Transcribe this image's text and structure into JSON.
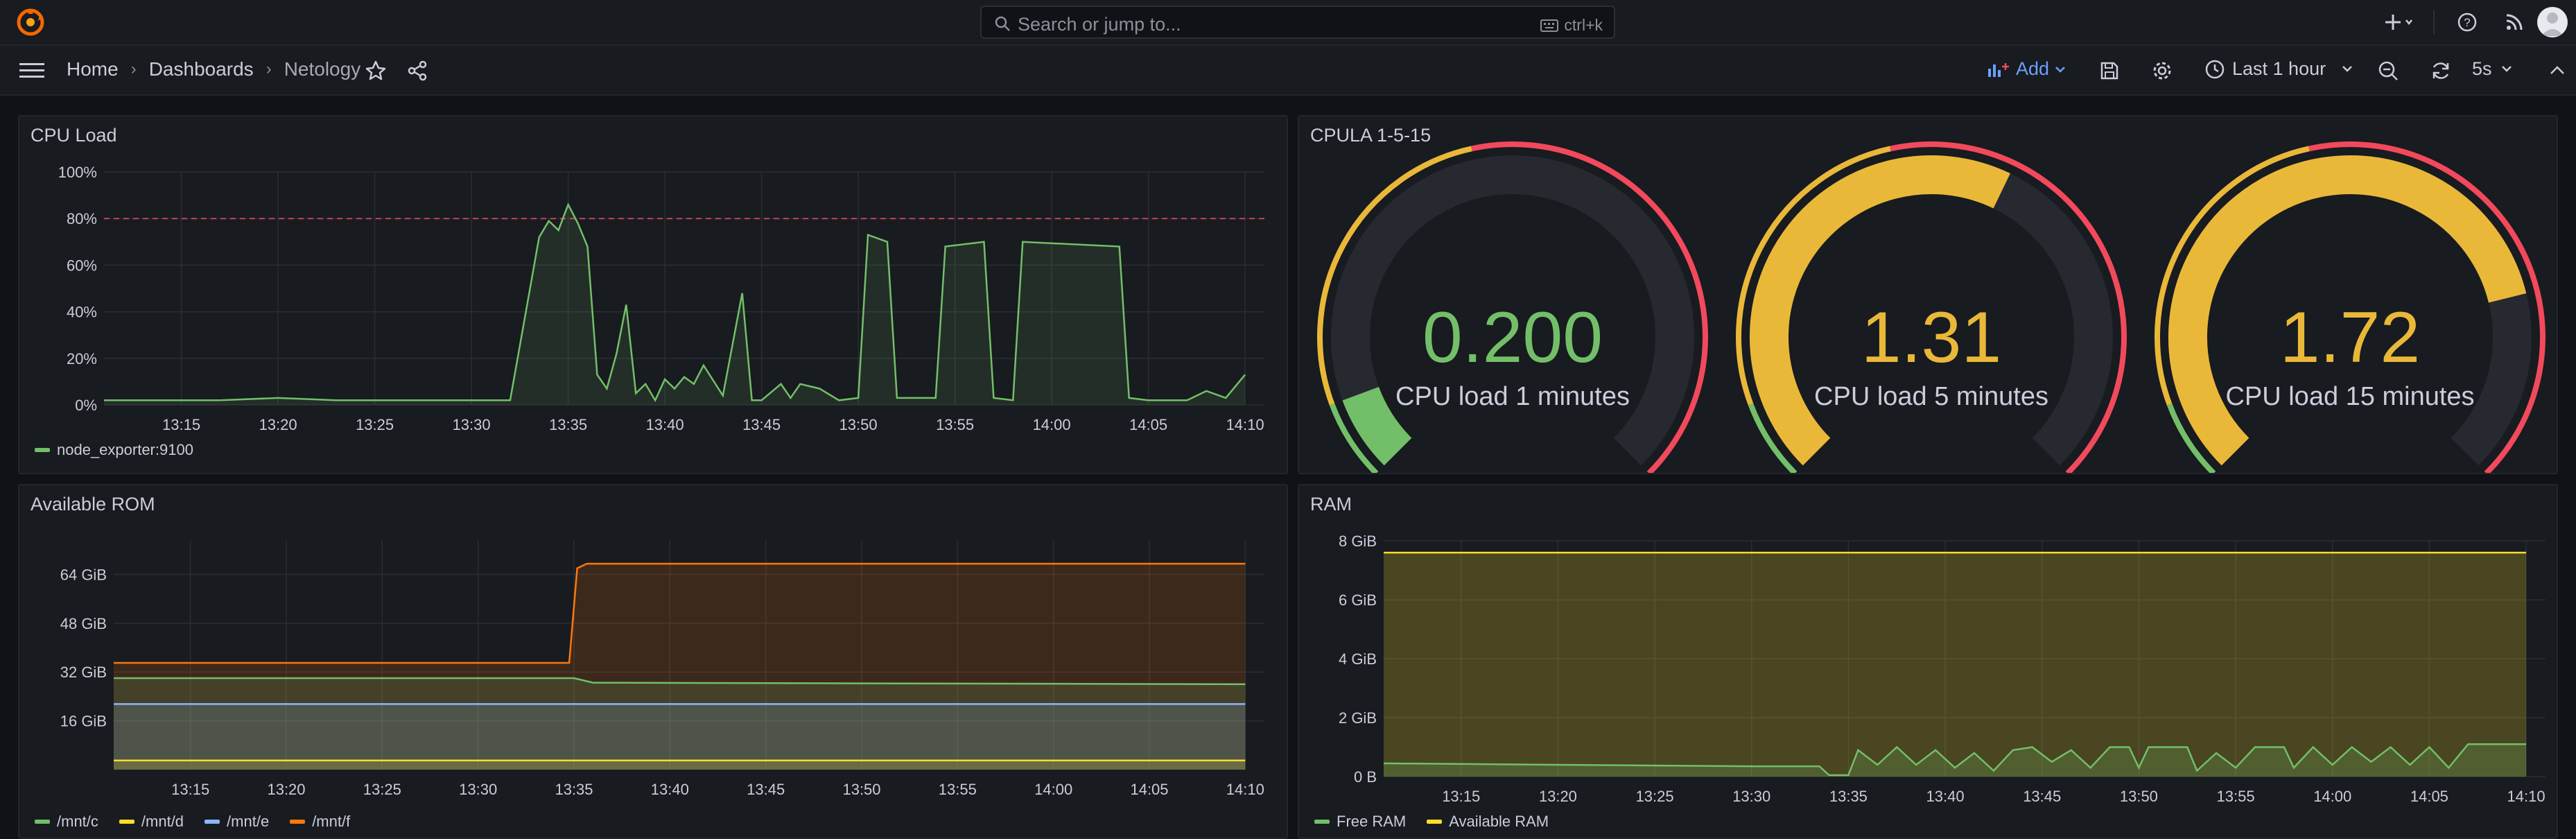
{
  "topbar": {
    "search_placeholder": "Search or jump to...",
    "search_shortcut": "ctrl+k"
  },
  "breadcrumb": {
    "home": "Home",
    "dashboards": "Dashboards",
    "current": "Netology"
  },
  "toolbar": {
    "add_label": "Add",
    "time_range": "Last 1 hour",
    "refresh_interval": "5s"
  },
  "colors": {
    "green": "#73bf69",
    "yellow": "#fade2a",
    "gold": "#eab839",
    "red": "#f2495c",
    "blue": "#8ab8ff",
    "orange": "#ff780a",
    "accent": "#6e9fff"
  },
  "panels": {
    "cpu_load": {
      "title": "CPU Load"
    },
    "cpula": {
      "title": "CPULA 1-5-15"
    },
    "rom": {
      "title": "Available ROM"
    },
    "ram": {
      "title": "RAM"
    }
  },
  "chart_data": [
    {
      "id": "cpu-load",
      "type": "line",
      "title": "CPU Load",
      "x_ticks": [
        "13:15",
        "13:20",
        "13:25",
        "13:30",
        "13:35",
        "13:40",
        "13:45",
        "13:50",
        "13:55",
        "14:00",
        "14:05",
        "14:10"
      ],
      "y_ticks": [
        "0%",
        "20%",
        "40%",
        "60%",
        "80%",
        "100%"
      ],
      "ylim": [
        0,
        100
      ],
      "threshold": 80,
      "series": [
        {
          "name": "node_exporter:9100",
          "color": "#73bf69",
          "points": [
            [
              "13:11:00",
              2
            ],
            [
              "13:14:00",
              2
            ],
            [
              "13:17:00",
              2
            ],
            [
              "13:20:00",
              3
            ],
            [
              "13:23:00",
              2
            ],
            [
              "13:26:00",
              2
            ],
            [
              "13:29:00",
              2
            ],
            [
              "13:32:00",
              2
            ],
            [
              "13:33:30",
              72
            ],
            [
              "13:34:00",
              79
            ],
            [
              "13:34:30",
              75
            ],
            [
              "13:35:00",
              86
            ],
            [
              "13:35:30",
              78
            ],
            [
              "13:36:00",
              68
            ],
            [
              "13:36:30",
              13
            ],
            [
              "13:37:00",
              7
            ],
            [
              "13:37:30",
              22
            ],
            [
              "13:38:00",
              43
            ],
            [
              "13:38:30",
              5
            ],
            [
              "13:39:00",
              9
            ],
            [
              "13:39:30",
              2
            ],
            [
              "13:40:00",
              11
            ],
            [
              "13:40:30",
              7
            ],
            [
              "13:41:00",
              12
            ],
            [
              "13:41:30",
              9
            ],
            [
              "13:42:00",
              17
            ],
            [
              "13:43:00",
              4
            ],
            [
              "13:44:00",
              48
            ],
            [
              "13:44:30",
              2
            ],
            [
              "13:45:00",
              2
            ],
            [
              "13:46:00",
              9
            ],
            [
              "13:46:30",
              3
            ],
            [
              "13:47:00",
              9
            ],
            [
              "13:48:00",
              7
            ],
            [
              "13:49:00",
              2
            ],
            [
              "13:50:00",
              3
            ],
            [
              "13:50:30",
              73
            ],
            [
              "13:51:30",
              70
            ],
            [
              "13:52:00",
              3
            ],
            [
              "13:53:00",
              3
            ],
            [
              "13:54:00",
              3
            ],
            [
              "13:54:30",
              68
            ],
            [
              "13:56:30",
              70
            ],
            [
              "13:57:00",
              3
            ],
            [
              "13:58:00",
              2
            ],
            [
              "13:58:30",
              70
            ],
            [
              "14:03:30",
              68
            ],
            [
              "14:04:00",
              3
            ],
            [
              "14:05:00",
              2
            ],
            [
              "14:07:00",
              2
            ],
            [
              "14:08:00",
              6
            ],
            [
              "14:09:00",
              3
            ],
            [
              "14:10:00",
              13
            ]
          ]
        }
      ]
    },
    {
      "id": "cpula",
      "type": "gauge",
      "title": "CPULA 1-5-15",
      "gauges": [
        {
          "label": "CPU load 1 minutes",
          "value": 0.2,
          "display": "0.200",
          "color": "#73bf69",
          "max": 2.2,
          "thresholds": [
            0.2,
            1.0
          ]
        },
        {
          "label": "CPU load 5 minutes",
          "value": 1.31,
          "display": "1.31",
          "color": "#eab839",
          "max": 2.2,
          "thresholds": [
            0.2,
            1.0
          ]
        },
        {
          "label": "CPU load 15 minutes",
          "value": 1.72,
          "display": "1.72",
          "color": "#eab839",
          "max": 2.2,
          "thresholds": [
            0.2,
            1.0
          ]
        }
      ]
    },
    {
      "id": "available-rom",
      "type": "area",
      "title": "Available ROM",
      "x_ticks": [
        "13:15",
        "13:20",
        "13:25",
        "13:30",
        "13:35",
        "13:40",
        "13:45",
        "13:50",
        "13:55",
        "14:00",
        "14:05",
        "14:10"
      ],
      "y_ticks": [
        "16 GiB",
        "32 GiB",
        "48 GiB",
        "64 GiB"
      ],
      "ylim_gib": [
        0,
        75
      ],
      "series": [
        {
          "name": "/mnt/c",
          "color": "#73bf69",
          "points": [
            [
              "13:11:00",
              30
            ],
            [
              "13:35:00",
              30
            ],
            [
              "13:36:00",
              28.5
            ],
            [
              "14:10:00",
              28
            ]
          ]
        },
        {
          "name": "/mnt/d",
          "color": "#fade2a",
          "points": [
            [
              "13:11:00",
              3
            ],
            [
              "14:10:00",
              3
            ]
          ]
        },
        {
          "name": "/mnt/e",
          "color": "#8ab8ff",
          "points": [
            [
              "13:11:00",
              21.5
            ],
            [
              "14:10:00",
              21.5
            ]
          ]
        },
        {
          "name": "/mnt/f",
          "color": "#ff780a",
          "points": [
            [
              "13:11:00",
              35
            ],
            [
              "13:34:45",
              35
            ],
            [
              "13:35:10",
              66
            ],
            [
              "13:35:40",
              67.5
            ],
            [
              "14:10:00",
              67.5
            ]
          ]
        }
      ]
    },
    {
      "id": "ram",
      "type": "area",
      "title": "RAM",
      "x_ticks": [
        "13:15",
        "13:20",
        "13:25",
        "13:30",
        "13:35",
        "13:40",
        "13:45",
        "13:50",
        "13:55",
        "14:00",
        "14:05",
        "14:10"
      ],
      "y_ticks": [
        "0 B",
        "2 GiB",
        "4 GiB",
        "6 GiB",
        "8 GiB"
      ],
      "ylim_gib": [
        0,
        8
      ],
      "series": [
        {
          "name": "Free RAM",
          "color": "#73bf69",
          "points": [
            [
              "13:11:00",
              0.45
            ],
            [
              "13:20:00",
              0.4
            ],
            [
              "13:30:00",
              0.35
            ],
            [
              "13:33:30",
              0.35
            ],
            [
              "13:34:00",
              0.05
            ],
            [
              "13:35:00",
              0.05
            ],
            [
              "13:35:30",
              0.9
            ],
            [
              "13:36:30",
              0.4
            ],
            [
              "13:37:30",
              1.0
            ],
            [
              "13:38:30",
              0.4
            ],
            [
              "13:39:30",
              0.9
            ],
            [
              "13:40:30",
              0.3
            ],
            [
              "13:41:30",
              0.8
            ],
            [
              "13:42:30",
              0.2
            ],
            [
              "13:43:30",
              0.9
            ],
            [
              "13:44:30",
              1.0
            ],
            [
              "13:45:30",
              0.5
            ],
            [
              "13:46:30",
              0.9
            ],
            [
              "13:47:30",
              0.3
            ],
            [
              "13:48:30",
              1.0
            ],
            [
              "13:49:30",
              1.0
            ],
            [
              "13:50:00",
              0.3
            ],
            [
              "13:50:30",
              1.0
            ],
            [
              "13:52:30",
              1.0
            ],
            [
              "13:53:00",
              0.2
            ],
            [
              "13:54:00",
              0.8
            ],
            [
              "13:55:00",
              0.3
            ],
            [
              "13:56:00",
              1.0
            ],
            [
              "13:57:30",
              1.0
            ],
            [
              "13:58:00",
              0.3
            ],
            [
              "13:59:00",
              1.0
            ],
            [
              "14:00:00",
              0.4
            ],
            [
              "14:01:00",
              1.0
            ],
            [
              "14:02:00",
              0.5
            ],
            [
              "14:03:00",
              1.0
            ],
            [
              "14:04:00",
              0.4
            ],
            [
              "14:05:00",
              1.0
            ],
            [
              "14:06:00",
              0.3
            ],
            [
              "14:07:00",
              1.1
            ],
            [
              "14:10:00",
              1.1
            ]
          ]
        },
        {
          "name": "Available RAM",
          "color": "#fade2a",
          "points": [
            [
              "13:11:00",
              7.6
            ],
            [
              "14:10:00",
              7.6
            ]
          ]
        }
      ]
    }
  ]
}
